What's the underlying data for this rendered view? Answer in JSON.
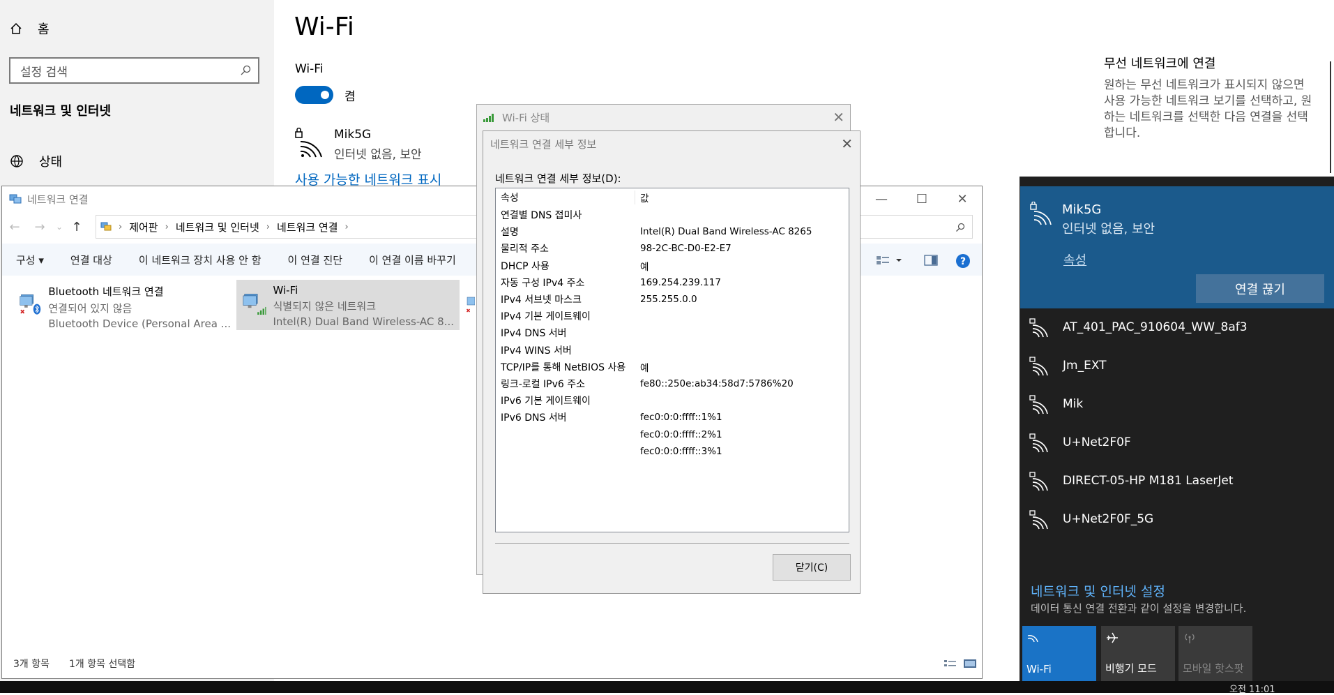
{
  "settings": {
    "home_label": "홈",
    "search_placeholder": "설정 검색",
    "category_title": "네트워크 및 인터넷",
    "status_label": "상태",
    "page_title": "Wi-Fi",
    "wifi_label": "Wi-Fi",
    "toggle_state": "켬",
    "current_network_name": "Mik5G",
    "current_network_status": "인터넷 없음, 보안",
    "show_networks_link": "사용 가능한 네트워크 표시",
    "related_heading": "무선 네트워크에 연결",
    "related_desc": "원하는 무선 네트워크가 표시되지 않으면 사용 가능한 네트워크 보기를 선택하고, 원하는 네트워크를 선택한 다음 연결을 선택합니다."
  },
  "netconn": {
    "window_title": "네트워크 연결",
    "breadcrumb": [
      "제어판",
      "네트워크 및 인터넷",
      "네트워크 연결"
    ],
    "toolbar": [
      "구성 ▾",
      "연결 대상",
      "이 네트워크 장치 사용 안 함",
      "이 연결 진단",
      "이 연결 이름 바꾸기"
    ],
    "items": [
      {
        "name": "Bluetooth 네트워크 연결",
        "status": "연결되어 있지 않음",
        "device": "Bluetooth Device (Personal Area ..."
      },
      {
        "name": "Wi-Fi",
        "status": "식별되지 않은 네트워크",
        "device": "Intel(R) Dual Band Wireless-AC 8..."
      }
    ],
    "status_count": "3개 항목",
    "status_selected": "1개 항목 선택함"
  },
  "wifi_status_dialog": {
    "title": "Wi-Fi 상태"
  },
  "details_dialog": {
    "title": "네트워크 연결 세부 정보",
    "list_label": "네트워크 연결 세부 정보(D):",
    "col_property": "속성",
    "col_value": "값",
    "rows": [
      {
        "p": "연결별 DNS 접미사",
        "v": ""
      },
      {
        "p": "설명",
        "v": "Intel(R) Dual Band Wireless-AC 8265"
      },
      {
        "p": "물리적 주소",
        "v": "98-2C-BC-D0-E2-E7"
      },
      {
        "p": "DHCP 사용",
        "v": "예"
      },
      {
        "p": "자동 구성 IPv4 주소",
        "v": "169.254.239.117"
      },
      {
        "p": "IPv4 서브넷 마스크",
        "v": "255.255.0.0"
      },
      {
        "p": "IPv4 기본 게이트웨이",
        "v": ""
      },
      {
        "p": "IPv4 DNS 서버",
        "v": ""
      },
      {
        "p": "IPv4 WINS 서버",
        "v": ""
      },
      {
        "p": "TCP/IP를 통해 NetBIOS 사용",
        "v": "예"
      },
      {
        "p": "링크-로컬 IPv6 주소",
        "v": "fe80::250e:ab34:58d7:5786%20"
      },
      {
        "p": "IPv6 기본 게이트웨이",
        "v": ""
      },
      {
        "p": "IPv6 DNS 서버",
        "v": "fec0:0:0:ffff::1%1"
      },
      {
        "p": "",
        "v": "fec0:0:0:ffff::2%1"
      },
      {
        "p": "",
        "v": "fec0:0:0:ffff::3%1"
      }
    ],
    "close_button": "닫기(C)"
  },
  "flyout": {
    "current_name": "Mik5G",
    "current_status": "인터넷 없음, 보안",
    "properties_link": "속성",
    "disconnect_button": "연결 끊기",
    "networks": [
      "AT_401_PAC_910604_WW_8af3",
      "Jm_EXT",
      "Mik",
      "U+Net2F0F",
      "DIRECT-05-HP M181 LaserJet",
      "U+Net2F0F_5G"
    ],
    "settings_link": "네트워크 및 인터넷 설정",
    "settings_desc": "데이터 통신 연결 전환과 같이 설정을 변경합니다.",
    "tiles": [
      "Wi-Fi",
      "비행기 모드",
      "모바일 핫스팟"
    ]
  },
  "taskbar": {
    "clock": "오전 11:01"
  },
  "colors": {
    "accent": "#0067c0",
    "flyout_bg": "#1f1f1f",
    "flyout_current_bg": "#1b5a8c",
    "tile_active": "#1a73c6"
  }
}
